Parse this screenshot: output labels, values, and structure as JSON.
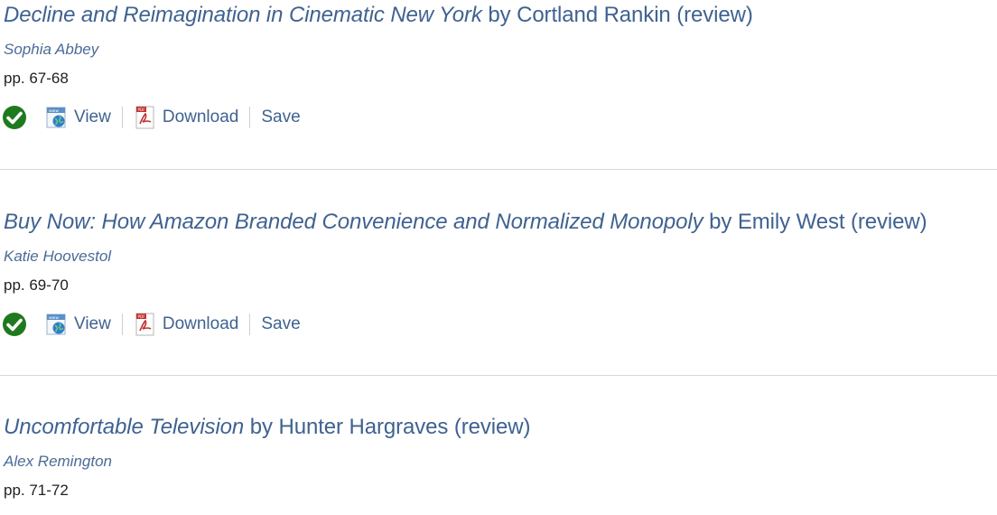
{
  "items": [
    {
      "book_title": "Decline and Reimagination in Cinematic New York",
      "byline": " by Cortland Rankin (review)",
      "author": "Sophia Abbey",
      "pages": "pp. 67-68",
      "actions": {
        "view": "View",
        "download": "Download",
        "save": "Save"
      }
    },
    {
      "book_title": "Buy Now: How Amazon Branded Convenience and Normalized Monopoly",
      "byline": " by Emily West (review)",
      "author": "Katie Hoovestol",
      "pages": "pp. 69-70",
      "actions": {
        "view": "View",
        "download": "Download",
        "save": "Save"
      }
    },
    {
      "book_title": "Uncomfortable Television",
      "byline": " by Hunter Hargraves (review)",
      "author": "Alex Remington",
      "pages": "pp. 71-72"
    }
  ],
  "icons": {
    "access": "green-check-circle-icon",
    "view": "html-globe-icon",
    "download": "pdf-icon"
  },
  "colors": {
    "link": "#3f6290",
    "access_green": "#1f7a1f",
    "pdf_red": "#c4302b",
    "divider": "#d9d9d9"
  }
}
